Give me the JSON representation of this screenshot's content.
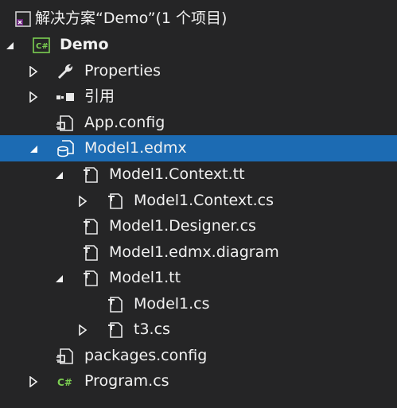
{
  "solution": {
    "label": "解决方案“Demo”(1 个项目)"
  },
  "project": {
    "label": "Demo",
    "icon": "csharp-project-icon"
  },
  "items": [
    {
      "label": "Properties",
      "icon": "wrench-icon"
    },
    {
      "label": "引用",
      "icon": "references-icon"
    },
    {
      "label": "App.config",
      "icon": "config-file-icon"
    },
    {
      "label": "Model1.edmx",
      "icon": "edmx-file-icon"
    },
    {
      "label": "Model1.Context.tt",
      "icon": "template-file-icon"
    },
    {
      "label": "Model1.Context.cs",
      "icon": "template-file-icon"
    },
    {
      "label": "Model1.Designer.cs",
      "icon": "template-file-icon"
    },
    {
      "label": "Model1.edmx.diagram",
      "icon": "template-file-icon"
    },
    {
      "label": "Model1.tt",
      "icon": "template-file-icon"
    },
    {
      "label": "Model1.cs",
      "icon": "template-file-icon"
    },
    {
      "label": "t3.cs",
      "icon": "template-file-icon"
    },
    {
      "label": "packages.config",
      "icon": "config-file-icon"
    },
    {
      "label": "Program.cs",
      "icon": "csharp-file-icon"
    }
  ],
  "colors": {
    "background": "#252526",
    "selection": "#1c6bb3",
    "text": "#f1f1f1",
    "csharp": "#7ccf52"
  }
}
